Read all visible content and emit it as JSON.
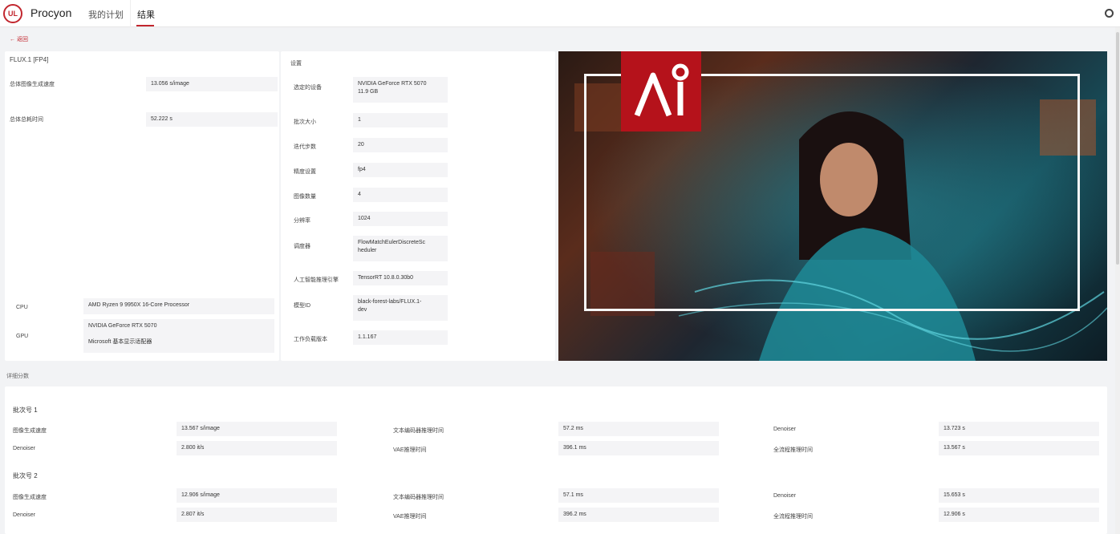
{
  "app": {
    "logo_text": "UL",
    "brand": "Procyon",
    "nav": [
      "我的计划",
      "结果"
    ]
  },
  "back_label": "返回",
  "left_card": {
    "title": "FLUX.1 [FP4]",
    "metrics": [
      {
        "label": "总体图像生成速度",
        "value": "13.056 s/image"
      },
      {
        "label": "总体总耗时间",
        "value": "52.222 s"
      }
    ],
    "hardware": [
      {
        "label": "CPU",
        "value": "AMD Ryzen 9 9950X 16-Core Processor"
      },
      {
        "label": "GPU",
        "value": "NVIDIA GeForce RTX 5070",
        "value2": "Microsoft 基本显示适配器"
      }
    ]
  },
  "settings_card": {
    "title": "设置",
    "rows": [
      {
        "label": "选定的设备",
        "value": "NVIDIA GeForce RTX 5070",
        "value2": "11.9 GB"
      },
      {
        "label": "批次大小",
        "value": "1"
      },
      {
        "label": "迭代步数",
        "value": "20"
      },
      {
        "label": "精度设置",
        "value": "fp4"
      },
      {
        "label": "图像数量",
        "value": "4"
      },
      {
        "label": "分辨率",
        "value": "1024"
      },
      {
        "label": "调度器",
        "value": "FlowMatchEulerDiscreteSc",
        "value2": "heduler"
      },
      {
        "label": "人工智能推理引擎",
        "value": "TensorRT 10.8.0.30b0"
      },
      {
        "label": "模型ID",
        "value": "black-forest-labs/FLUX.1-",
        "value2": "dev"
      },
      {
        "label": "工作负载版本",
        "value": "1.1.167"
      }
    ]
  },
  "hero": {
    "mark_text": "AI"
  },
  "detail_section": {
    "title": "详细分数",
    "batches": [
      {
        "name": "批次号 1",
        "rows": [
          [
            {
              "label": "图像生成速度",
              "value": "13.567 s/image"
            },
            {
              "label": "文本编码器推理时间",
              "value": "57.2 ms"
            },
            {
              "label": "Denoiser",
              "value": "13.723 s"
            }
          ],
          [
            {
              "label": "Denoiser",
              "value": "2.800 it/s"
            },
            {
              "label": "VAE推理时间",
              "value": "396.1 ms"
            },
            {
              "label": "全流程推理时间",
              "value": "13.567 s"
            }
          ]
        ]
      },
      {
        "name": "批次号 2",
        "rows": [
          [
            {
              "label": "图像生成速度",
              "value": "12.906 s/image"
            },
            {
              "label": "文本编码器推理时间",
              "value": "57.1 ms"
            },
            {
              "label": "Denoiser",
              "value": "15.653 s"
            }
          ],
          [
            {
              "label": "Denoiser",
              "value": "2.807 it/s"
            },
            {
              "label": "VAE推理时间",
              "value": "396.2 ms"
            },
            {
              "label": "全流程推理时间",
              "value": "12.906 s"
            }
          ]
        ]
      }
    ]
  }
}
